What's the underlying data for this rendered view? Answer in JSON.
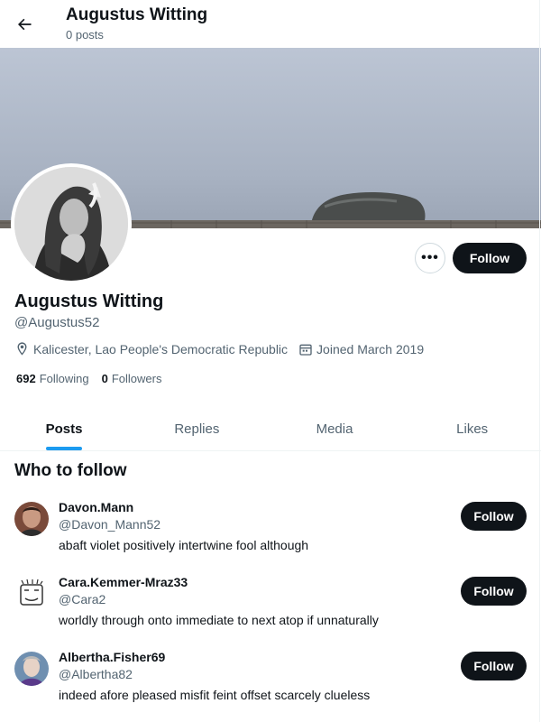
{
  "header": {
    "name": "Augustus Witting",
    "posts": "0 posts",
    "back_icon": "back-arrow-icon"
  },
  "profile": {
    "name": "Augustus Witting",
    "handle": "@Augustus52",
    "location": "Kalicester, Lao People's Democratic Republic",
    "joined": "Joined March 2019",
    "following_count": "692",
    "following_label": "Following",
    "followers_count": "0",
    "followers_label": "Followers",
    "more_label": "•••",
    "follow_label": "Follow"
  },
  "tabs": [
    {
      "label": "Posts",
      "active": true
    },
    {
      "label": "Replies",
      "active": false
    },
    {
      "label": "Media",
      "active": false
    },
    {
      "label": "Likes",
      "active": false
    }
  ],
  "who_to_follow": {
    "title": "Who to follow",
    "items": [
      {
        "name": "Davon.Mann",
        "handle": "@Davon_Mann52",
        "bio": "abaft violet positively intertwine fool although",
        "follow_label": "Follow"
      },
      {
        "name": "Cara.Kemmer-Mraz33",
        "handle": "@Cara2",
        "bio": "worldly through onto immediate to next atop if unnaturally",
        "follow_label": "Follow"
      },
      {
        "name": "Albertha.Fisher69",
        "handle": "@Albertha82",
        "bio": "indeed afore pleased misfit feint offset scarcely clueless",
        "follow_label": "Follow"
      }
    ]
  },
  "colors": {
    "accent": "#1d9bf0",
    "button_dark": "#0f1419",
    "secondary_text": "#536471"
  }
}
